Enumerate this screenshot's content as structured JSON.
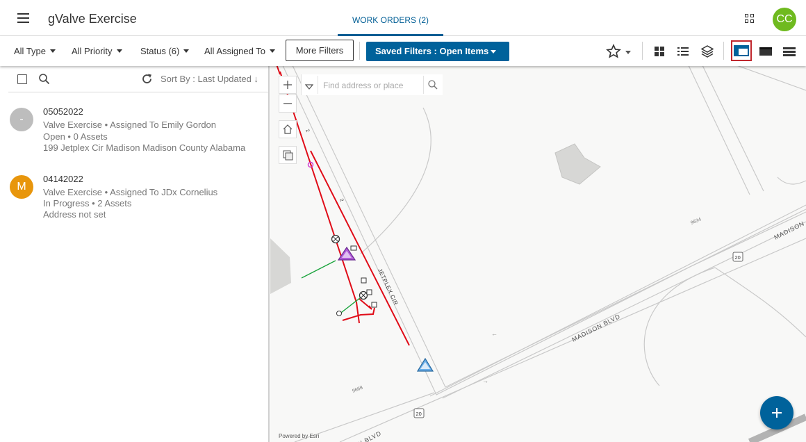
{
  "header": {
    "app_title": "gValve Exercise",
    "tab_work_orders": "WORK ORDERS (2)",
    "user_initials": "CC",
    "user_avatar_color": "#6fba1f"
  },
  "toolbar": {
    "type_filter": "All Type",
    "priority_filter": "All Priority",
    "status_filter": "Status (6)",
    "assigned_filter": "All Assigned To",
    "more_filters": "More Filters",
    "saved_filters": "Saved Filters : Open Items",
    "accent_color": "#00629b",
    "active_view_border": "#c0272d"
  },
  "list": {
    "sort_label": "Sort By : Last Updated",
    "items": [
      {
        "id": "05052022",
        "avatar_letter": "-",
        "avatar_color": "#bdbdbd",
        "line1": "Valve Exercise • Assigned To Emily Gordon",
        "line2": "Open • 0 Assets",
        "line3": "199 Jetplex Cir Madison Madison County Alabama"
      },
      {
        "id": "04142022",
        "avatar_letter": "M",
        "avatar_color": "#e8960c",
        "line1": "Valve Exercise • Assigned To JDx Cornelius",
        "line2": "In Progress • 2 Assets",
        "line3": "Address not set"
      }
    ]
  },
  "map": {
    "search_placeholder": "Find address or place",
    "powered_by": "Powered by Esri",
    "road_madison_blvd_1": "MADISON BLVD",
    "road_madison_blvd_2": "N BLVD",
    "road_madison_east": "MADISON",
    "road_jetplex": "JETPLEX CIR",
    "label_9634": "9634",
    "label_9668": "9668",
    "shield_20_a": "20",
    "shield_20_b": "20"
  }
}
